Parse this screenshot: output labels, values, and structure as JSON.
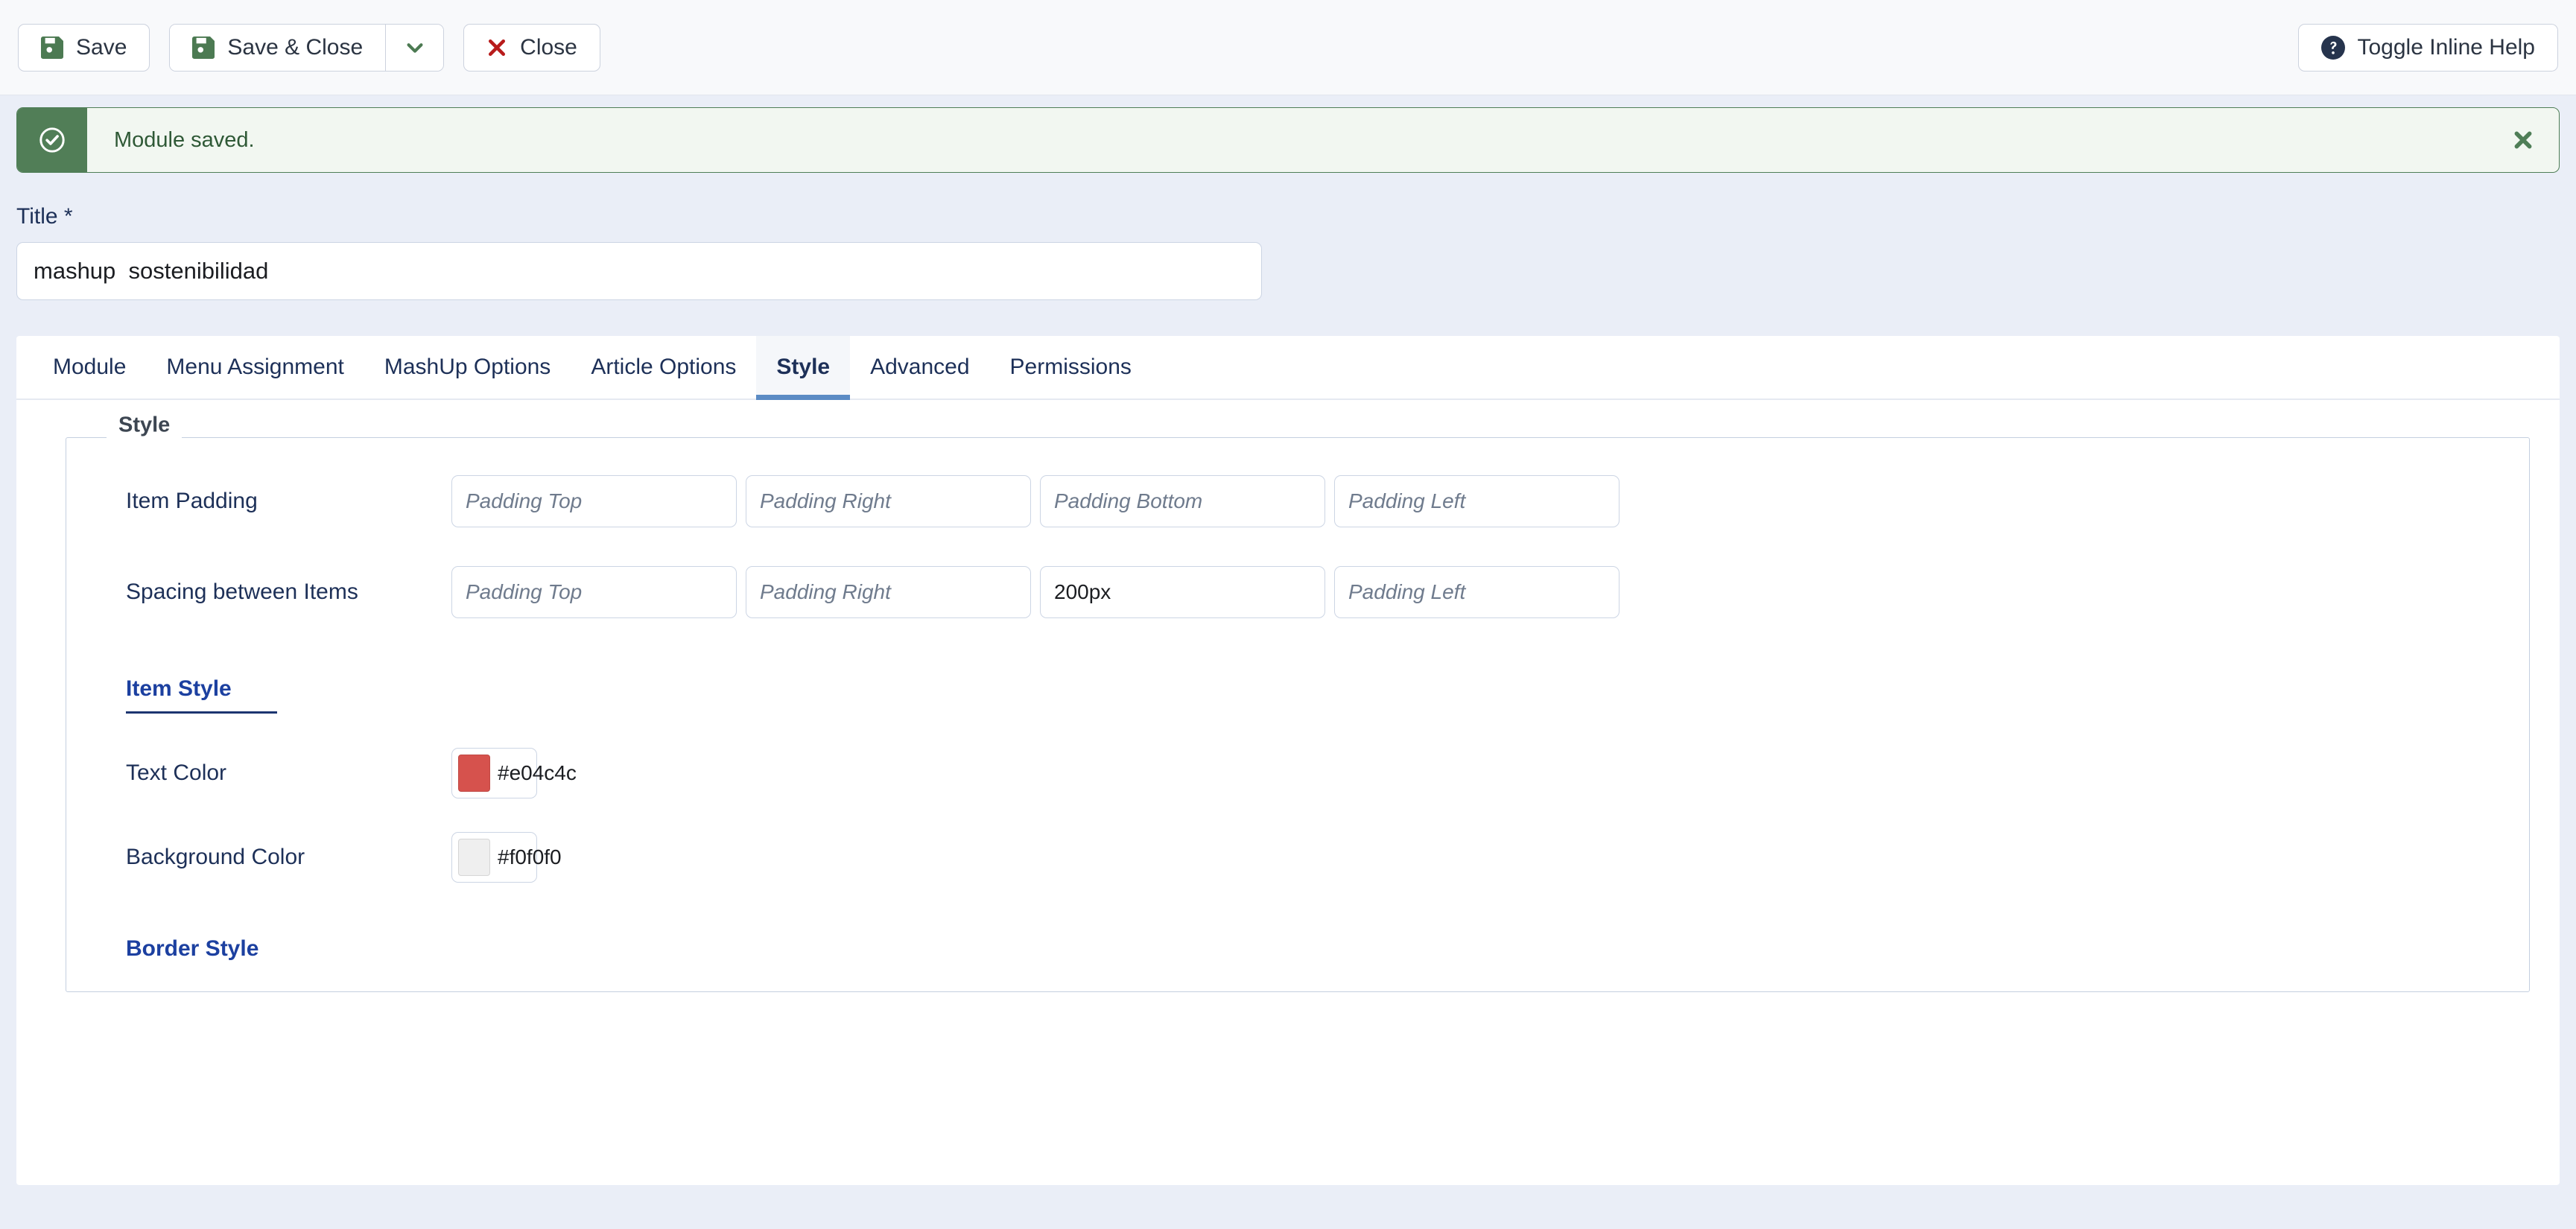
{
  "toolbar": {
    "save_label": "Save",
    "save_close_label": "Save & Close",
    "save_close_caret_icon": "chevron-down-icon",
    "close_label": "Close",
    "toggle_help_label": "Toggle Inline Help",
    "help_icon": "question-circle-icon",
    "save_icon": "floppy-disk-icon",
    "close_icon": "x-mark-icon"
  },
  "alert": {
    "message": "Module saved.",
    "status_icon": "check-circle-icon",
    "close_icon": "close-icon",
    "accent_color": "#517e57",
    "background_color": "#f2f7f1",
    "text_color": "#2f5936"
  },
  "title_field": {
    "label": "Title *",
    "value": "mashup  sostenibilidad",
    "placeholder": ""
  },
  "tabs": [
    {
      "label": "Module",
      "active": false
    },
    {
      "label": "Menu Assignment",
      "active": false
    },
    {
      "label": "MashUp Options",
      "active": false
    },
    {
      "label": "Article Options",
      "active": false
    },
    {
      "label": "Style",
      "active": true
    },
    {
      "label": "Advanced",
      "active": false
    },
    {
      "label": "Permissions",
      "active": false
    }
  ],
  "style_panel": {
    "legend": "Style",
    "item_padding": {
      "label": "Item Padding",
      "fields": [
        {
          "placeholder": "Padding Top",
          "value": ""
        },
        {
          "placeholder": "Padding Right",
          "value": ""
        },
        {
          "placeholder": "Padding Bottom",
          "value": ""
        },
        {
          "placeholder": "Padding Left",
          "value": ""
        }
      ]
    },
    "spacing_between_items": {
      "label": "Spacing between Items",
      "fields": [
        {
          "placeholder": "Padding Top",
          "value": ""
        },
        {
          "placeholder": "Padding Right",
          "value": ""
        },
        {
          "placeholder": "Padding Bottom",
          "value": "200px"
        },
        {
          "placeholder": "Padding Left",
          "value": ""
        }
      ]
    },
    "item_style_heading": "Item Style",
    "text_color": {
      "label": "Text Color",
      "value": "#e04c4c",
      "swatch_color": "#d6524d"
    },
    "background_color": {
      "label": "Background Color",
      "value": "#f0f0f0",
      "swatch_color": "#efefef"
    },
    "border_style_heading": "Border Style"
  }
}
